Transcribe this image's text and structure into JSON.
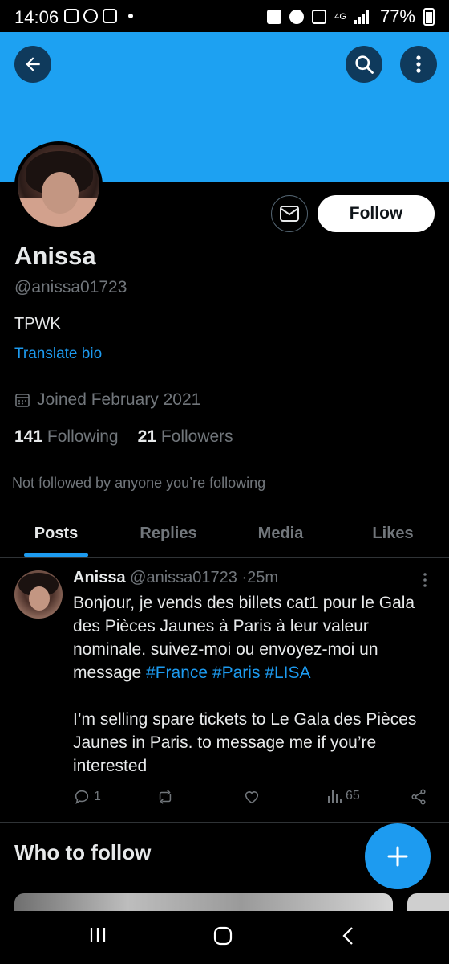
{
  "status_bar": {
    "time": "14:06",
    "battery": "77%",
    "network": "4G"
  },
  "header": {
    "back_icon": "arrow-left-icon",
    "search_icon": "search-icon",
    "more_icon": "more-vertical-icon",
    "banner_color": "#1da1f2"
  },
  "profile": {
    "name": "Anissa",
    "handle": "@anissa01723",
    "bio": "TPWK",
    "translate_label": "Translate bio",
    "joined": "Joined February 2021",
    "following_count": "141",
    "following_label": "Following",
    "followers_count": "21",
    "followers_label": "Followers",
    "not_followed_text": "Not followed by anyone you’re following",
    "follow_label": "Follow"
  },
  "tabs": [
    {
      "label": "Posts",
      "active": true
    },
    {
      "label": "Replies",
      "active": false
    },
    {
      "label": "Media",
      "active": false
    },
    {
      "label": "Likes",
      "active": false
    }
  ],
  "post": {
    "name": "Anissa",
    "handle": "@anissa01723",
    "separator": "·",
    "time": "25m",
    "text_line1": "Bonjour, je vends des billets cat1 pour le Gala des Pièces Jaunes à Paris à leur valeur nominale. suivez-moi ou envoyez-moi un message ",
    "hashtags": [
      "#France",
      "#Paris",
      "#LISA"
    ],
    "text_line2": "I’m selling spare tickets to Le Gala des Pièces Jaunes in Paris. to message me if you’re interested",
    "reply_count": "1",
    "views_count": "65"
  },
  "who_to_follow": {
    "title": "Who to follow"
  },
  "accent_color": "#1d9bf0"
}
